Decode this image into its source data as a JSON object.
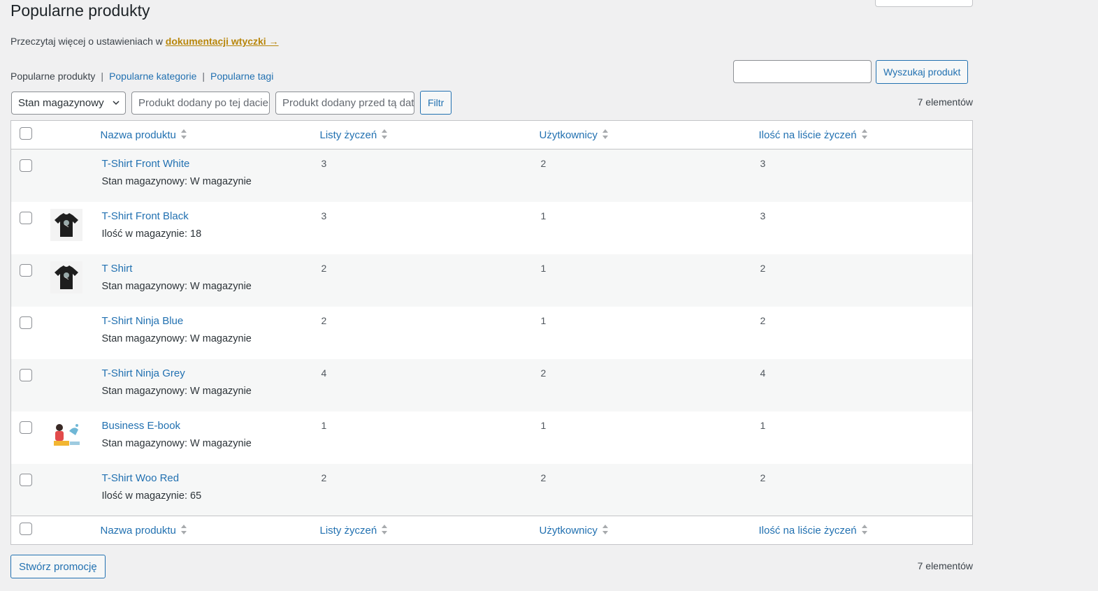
{
  "page": {
    "title": "Popularne produkty",
    "docs_prefix": "Przeczytaj więcej o ustawieniach w",
    "docs_link": "dokumentacji wtyczki →"
  },
  "subsub": {
    "current": "Popularne produkty",
    "sep": "|",
    "categories": "Popularne kategorie",
    "tags": "Popularne tagi"
  },
  "search": {
    "value": "",
    "button": "Wyszukaj produkt"
  },
  "filters": {
    "stock_select": "Stan magazynowy",
    "date_after_placeholder": "Produkt dodany po tej dacie",
    "date_before_placeholder": "Produkt dodany przed tą datą",
    "filter_button": "Filtr"
  },
  "items_count": "7 elementów",
  "columns": {
    "name": "Nazwa produktu",
    "wishlists": "Listy życzeń",
    "users": "Użytkownicy",
    "quantity": "Ilość na liście życzeń"
  },
  "rows": [
    {
      "name": "T-Shirt Front White",
      "stock": "Stan magazynowy: W magazynie",
      "wishlists": "3",
      "users": "2",
      "quantity": "3",
      "thumb": "none"
    },
    {
      "name": "T-Shirt Front Black",
      "stock": "Ilość w magazynie: 18",
      "wishlists": "3",
      "users": "1",
      "quantity": "3",
      "thumb": "tshirt-black"
    },
    {
      "name": "T Shirt",
      "stock": "Stan magazynowy: W magazynie",
      "wishlists": "2",
      "users": "1",
      "quantity": "2",
      "thumb": "tshirt-black"
    },
    {
      "name": "T-Shirt Ninja Blue",
      "stock": "Stan magazynowy: W magazynie",
      "wishlists": "2",
      "users": "1",
      "quantity": "2",
      "thumb": "none"
    },
    {
      "name": "T-Shirt Ninja Grey",
      "stock": "Stan magazynowy: W magazynie",
      "wishlists": "4",
      "users": "2",
      "quantity": "4",
      "thumb": "none"
    },
    {
      "name": "Business E-book",
      "stock": "Stan magazynowy: W magazynie",
      "wishlists": "1",
      "users": "1",
      "quantity": "1",
      "thumb": "ebook-illustration"
    },
    {
      "name": "T-Shirt Woo Red",
      "stock": "Ilość w magazynie: 65",
      "wishlists": "2",
      "users": "2",
      "quantity": "2",
      "thumb": "none"
    }
  ],
  "create_promo_button": "Stwórz promocję",
  "colors": {
    "link": "#2271b1",
    "docs_link": "#b8860b",
    "background": "#f0f0f1"
  }
}
